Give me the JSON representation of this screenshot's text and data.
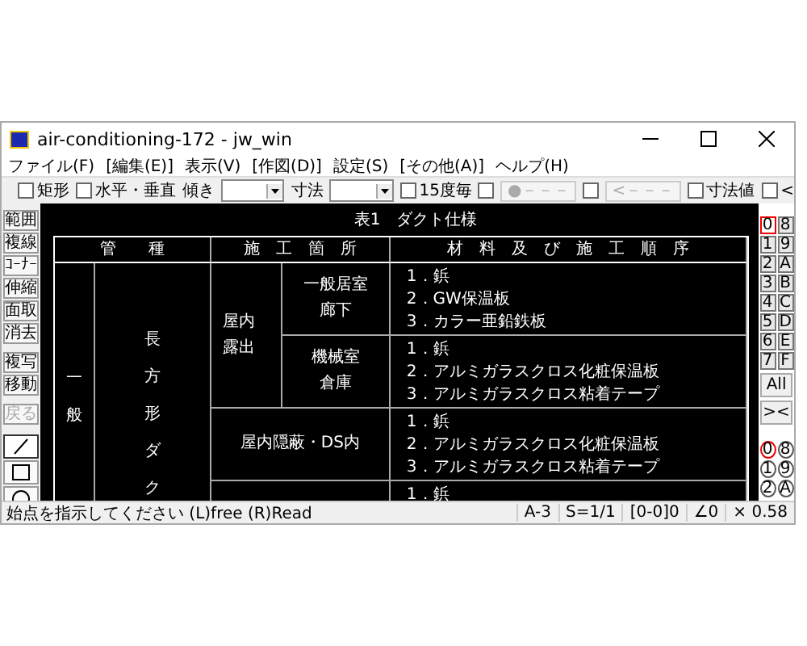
{
  "window": {
    "title": "air-conditioning-172 - jw_win"
  },
  "menu": [
    "ファイル(F)",
    "[編集(E)]",
    "表示(V)",
    "[作図(D)]",
    "設定(S)",
    "[その他(A)]",
    "ヘルプ(H)"
  ],
  "toolbar": [
    {
      "kind": "checkbox",
      "label": "矩形",
      "checked": false
    },
    {
      "kind": "checkbox",
      "label": "水平・垂直",
      "checked": false
    },
    {
      "kind": "label",
      "label": "傾き"
    },
    {
      "kind": "combo"
    },
    {
      "kind": "label",
      "label": "寸法"
    },
    {
      "kind": "combo"
    },
    {
      "kind": "checkbox",
      "label": "15度毎",
      "checked": false
    },
    {
      "kind": "checkbox",
      "checked": false
    },
    {
      "kind": "button",
      "label": "●－－－",
      "disabled": true
    },
    {
      "kind": "checkbox",
      "checked": false
    },
    {
      "kind": "button",
      "label": "<－－－",
      "disabled": true
    },
    {
      "kind": "checkbox",
      "label": "寸法値",
      "checked": false
    },
    {
      "kind": "checkbox",
      "label": "<",
      "checked": false
    }
  ],
  "tools": [
    {
      "label": "範囲",
      "disabled": false
    },
    {
      "label": "複線",
      "disabled": false
    },
    {
      "label": "ｺｰﾅｰ",
      "disabled": false
    },
    {
      "label": "伸縮",
      "disabled": false
    },
    {
      "label": "面取",
      "disabled": false
    },
    {
      "label": "消去",
      "disabled": false
    },
    {
      "label": "複写",
      "disabled": false
    },
    {
      "label": "移動",
      "disabled": false
    },
    {
      "label": "戻る",
      "disabled": true
    }
  ],
  "draw_tools": [
    {
      "kind": "line",
      "selected": true
    },
    {
      "kind": "rect",
      "selected": false
    },
    {
      "kind": "circle",
      "selected": false
    }
  ],
  "layer_groups": [
    {
      "label": "0",
      "selected": true
    },
    {
      "label": "8",
      "selected": false
    },
    {
      "label": "1",
      "selected": false
    },
    {
      "label": "9",
      "selected": false
    },
    {
      "label": "2",
      "selected": false
    },
    {
      "label": "A",
      "selected": false
    },
    {
      "label": "3",
      "selected": false
    },
    {
      "label": "B",
      "selected": false
    },
    {
      "label": "4",
      "selected": false
    },
    {
      "label": "C",
      "selected": false
    },
    {
      "label": "5",
      "selected": false
    },
    {
      "label": "D",
      "selected": false
    },
    {
      "label": "6",
      "selected": false
    },
    {
      "label": "E",
      "selected": false
    },
    {
      "label": "7",
      "selected": false
    },
    {
      "label": "F",
      "selected": false
    }
  ],
  "group_all": "All",
  "group_swap": "><",
  "layers": [
    {
      "label": "0",
      "selected": true
    },
    {
      "label": "8",
      "selected": false
    },
    {
      "label": "1",
      "selected": false
    },
    {
      "label": "9",
      "selected": false
    },
    {
      "label": "2",
      "selected": false
    },
    {
      "label": "A",
      "selected": false
    }
  ],
  "table": {
    "title": "表1　ダクト仕様",
    "headers": [
      "管　　種",
      "施　工　箇　所",
      "材　料　及　び　施　工　順　序"
    ],
    "category": "一般",
    "duct_type": "長方形ダク",
    "exposed": [
      "屋内",
      "露出"
    ],
    "rooms": [
      [
        "一般居室",
        "廊下"
      ],
      [
        "機械室",
        "倉庫"
      ]
    ],
    "concealed": "屋内隠蔽・DS内",
    "materials": [
      [
        "1．鋲",
        "2．GW保温板",
        "3．カラー亜鉛鉄板"
      ],
      [
        "1．鋲",
        "2．アルミガラスクロス化粧保温板",
        "3．アルミガラスクロス粘着テープ"
      ],
      [
        "1．鋲",
        "2．アルミガラスクロス化粧保温板",
        "3．アルミガラスクロス粘着テープ"
      ],
      [
        "1．鋲"
      ]
    ]
  },
  "status_bar": {
    "message": "始点を指示してください (L)free (R)Read",
    "fields": [
      "A-3",
      "S=1/1",
      "[0-0]0",
      "∠0",
      "× 0.58"
    ]
  }
}
